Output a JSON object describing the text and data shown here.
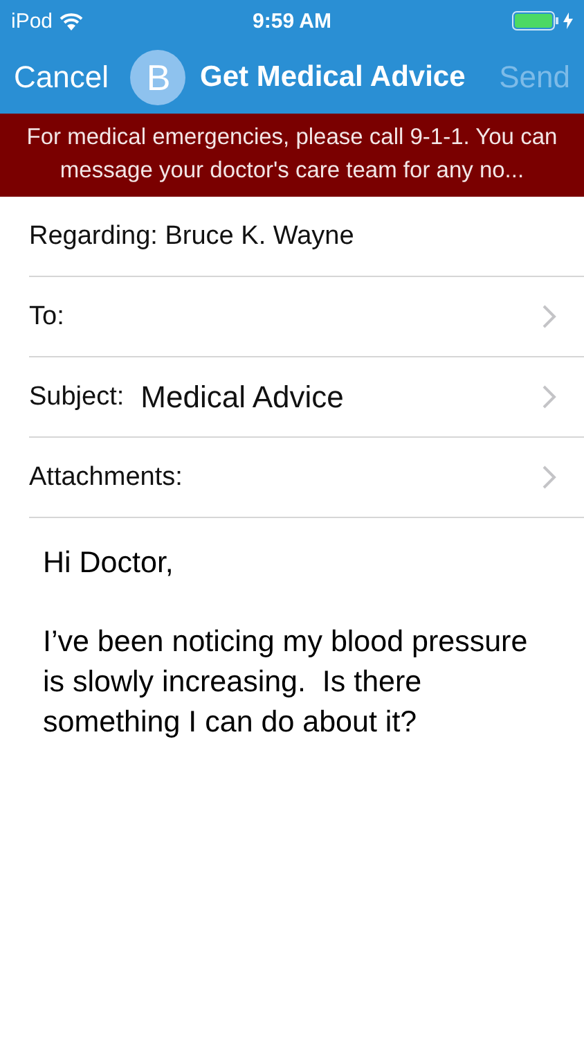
{
  "status_bar": {
    "carrier": "iPod",
    "time": "9:59 AM",
    "charging": true
  },
  "nav": {
    "cancel": "Cancel",
    "avatar_letter": "B",
    "title": "Get Medical Advice",
    "send": {
      "label": "Send",
      "disabled": true
    }
  },
  "banner": "For medical emergencies, please call 9-1-1. You can message your doctor's care team for any no...",
  "fields": [
    {
      "kind": "static",
      "label": "Regarding: Bruce K. Wayne"
    },
    {
      "kind": "link",
      "label": "To:"
    },
    {
      "kind": "link",
      "label": "Subject:",
      "value": "Medical Advice"
    },
    {
      "kind": "link",
      "label": "Attachments:"
    }
  ],
  "message": [
    "Hi Doctor,",
    "I’ve been noticing my blood pressure is slowly increasing.  Is there something I can do about it?"
  ]
}
